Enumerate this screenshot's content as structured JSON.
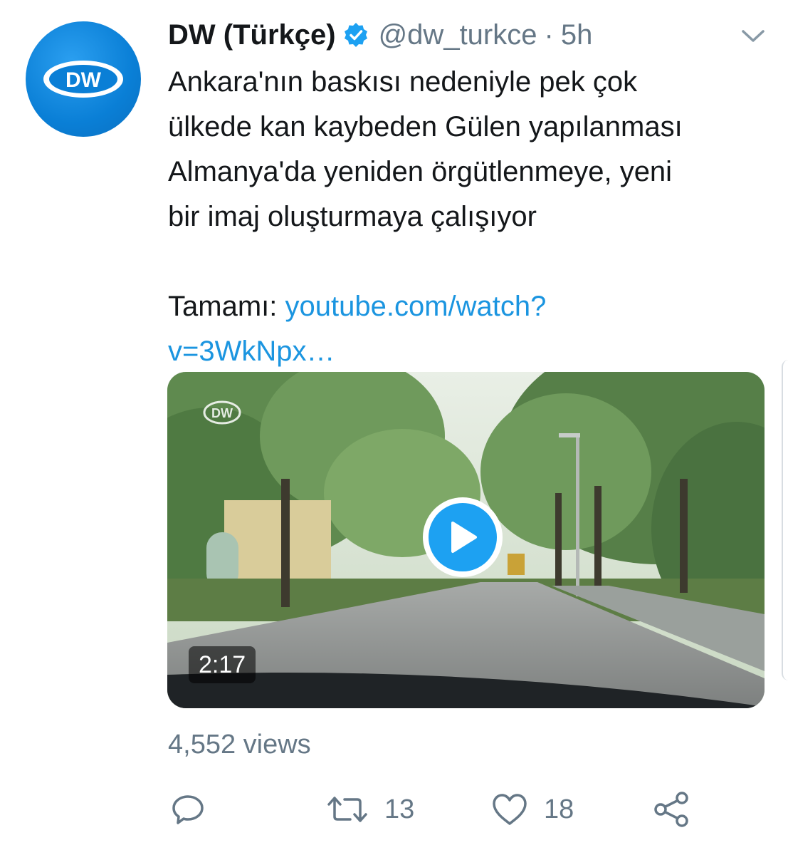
{
  "tweet": {
    "author_name": "DW (Türkçe)",
    "handle": "@dw_turkce",
    "separator": "·",
    "time": "5h",
    "avatar_text": "DW",
    "text_lines": [
      "Ankara'nın baskısı nedeniyle pek çok",
      "ülkede kan kaybeden Gülen yapılanması",
      "Almanya'da yeniden örgütlenmeye, yeni",
      "bir imaj oluşturmaya çalışıyor"
    ],
    "link_prefix": "Tamamı: ",
    "link_line1": "youtube.com/watch?",
    "link_line2": "v=3WkNpx…"
  },
  "media": {
    "duration": "2:17",
    "watermark": "DW"
  },
  "stats": {
    "views": "4,552 views"
  },
  "actions": {
    "retweets": "13",
    "likes": "18"
  },
  "colors": {
    "accent": "#1da1f2",
    "link": "#1b95e0",
    "secondary_text": "#657786",
    "primary_text": "#14171a",
    "dw_blue": "#0a7fd6"
  },
  "icons": {
    "reply": "reply-icon",
    "retweet": "retweet-icon",
    "like": "heart-icon",
    "share": "share-icon",
    "verified": "verified-badge-icon",
    "menu": "chevron-down-icon",
    "play": "play-icon"
  }
}
